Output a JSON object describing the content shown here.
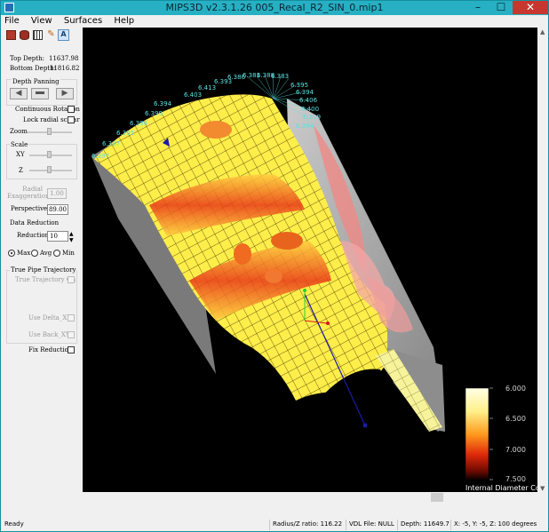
{
  "window": {
    "title": "MIPS3D v2.3.1.26  005_Recal_R2_SIN_0.mip1",
    "minimize": "–",
    "maximize": "☐",
    "close": "✕"
  },
  "menu": [
    "File",
    "View",
    "Surfaces",
    "Help"
  ],
  "toolbar": {
    "a_label": "A"
  },
  "panel": {
    "top_depth_label": "Top Depth:",
    "top_depth_value": "11637.98",
    "bottom_depth_label": "Bottom Depth:",
    "bottom_depth_value": "11816.82",
    "depth_panning": "Depth Panning",
    "continuous_rotation": "Continuous Rotation",
    "lock_radial_scalar": "Lock radial scalar",
    "zoom": "Zoom",
    "scale": "Scale",
    "xy": "XY",
    "z": "Z",
    "radial_exaggeration": "Radial Exaggeration",
    "radial_value": "1.00",
    "perspective": "Perspective",
    "perspective_value": "89.00",
    "data_reduction": "Data Reduction",
    "reduction": "Reduction",
    "reduction_value": "10",
    "max": "Max",
    "avg": "Avg",
    "min": "Min",
    "true_pipe_trajectory": "True Pipe Trajectory",
    "true_trajectory_on": "True Trajectory On",
    "use_delta_xy": "Use Delta_XY",
    "use_back_xy": "Use Back_XY",
    "fix_reduction": "Fix Reduction"
  },
  "viewport": {
    "top_labels": [
      "6.397",
      "6.387",
      "6.395",
      "6.394",
      "6.399",
      "6.394",
      "6.403",
      "6.413",
      "6.393",
      "6.386",
      "6.381",
      "6.388",
      "6.383"
    ],
    "right_labels": [
      "6.395",
      "6.394",
      "6.406",
      "6.400",
      "6.399",
      "6.394"
    ],
    "colorbar": {
      "ticks": [
        "6.000",
        "6.500",
        "7.000",
        "7.500"
      ],
      "title": "Internal Diameter Co"
    }
  },
  "status": {
    "ready": "Ready",
    "radius_ratio": "Radius/Z ratio: 116.22",
    "vdl": "VDL File: NULL",
    "depth": "Depth:  11649.7",
    "xyz": "X: -5, Y: -5, Z: 100 degrees"
  }
}
